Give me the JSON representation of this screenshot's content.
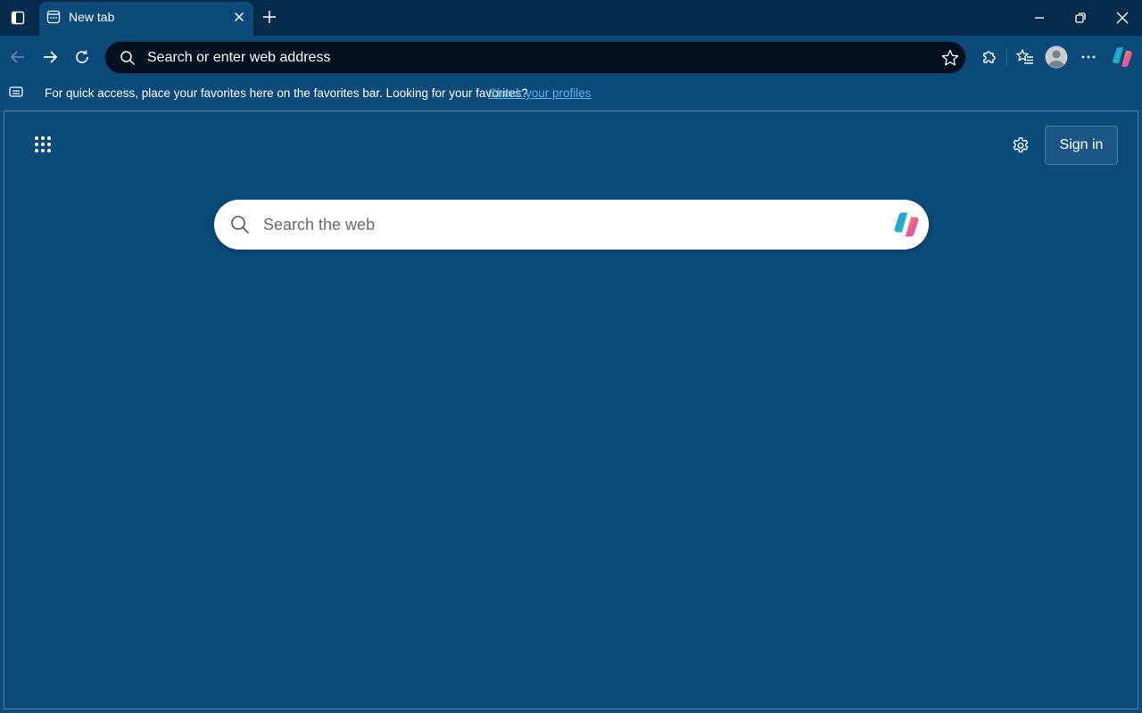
{
  "colors": {
    "page_background": "#0c4a7a",
    "titlebar_background": "#062a4a",
    "address_bar_background": "#03101f",
    "link": "#5ab0ef",
    "search_box_background": "#ffffff"
  },
  "titlebar": {
    "tab_actions_icon": "tab-actions-icon",
    "tabs": [
      {
        "title": "New tab",
        "active": true,
        "icon": "new-tab-page-icon"
      }
    ],
    "new_tab_icon": "plus-icon",
    "window_controls": [
      "minimize-icon",
      "restore-icon",
      "close-icon"
    ]
  },
  "toolbar": {
    "back_icon": "arrow-left-icon",
    "forward_icon": "arrow-right-icon",
    "refresh_icon": "refresh-icon",
    "address": {
      "placeholder": "Search or enter web address",
      "value": ""
    },
    "right_icons": [
      "extensions-icon",
      "favorites-icon",
      "profile-avatar",
      "more-options-icon",
      "copilot-icon"
    ]
  },
  "favorites_bar": {
    "message": "For quick access, place your favorites here on the favorites bar. Looking for your favorites?",
    "link_text": "Check your profiles"
  },
  "new_tab_page": {
    "apps_icon": "app-launcher-icon",
    "settings_icon": "gear-icon",
    "sign_in_label": "Sign in",
    "search": {
      "placeholder": "Search the web",
      "value": ""
    }
  }
}
